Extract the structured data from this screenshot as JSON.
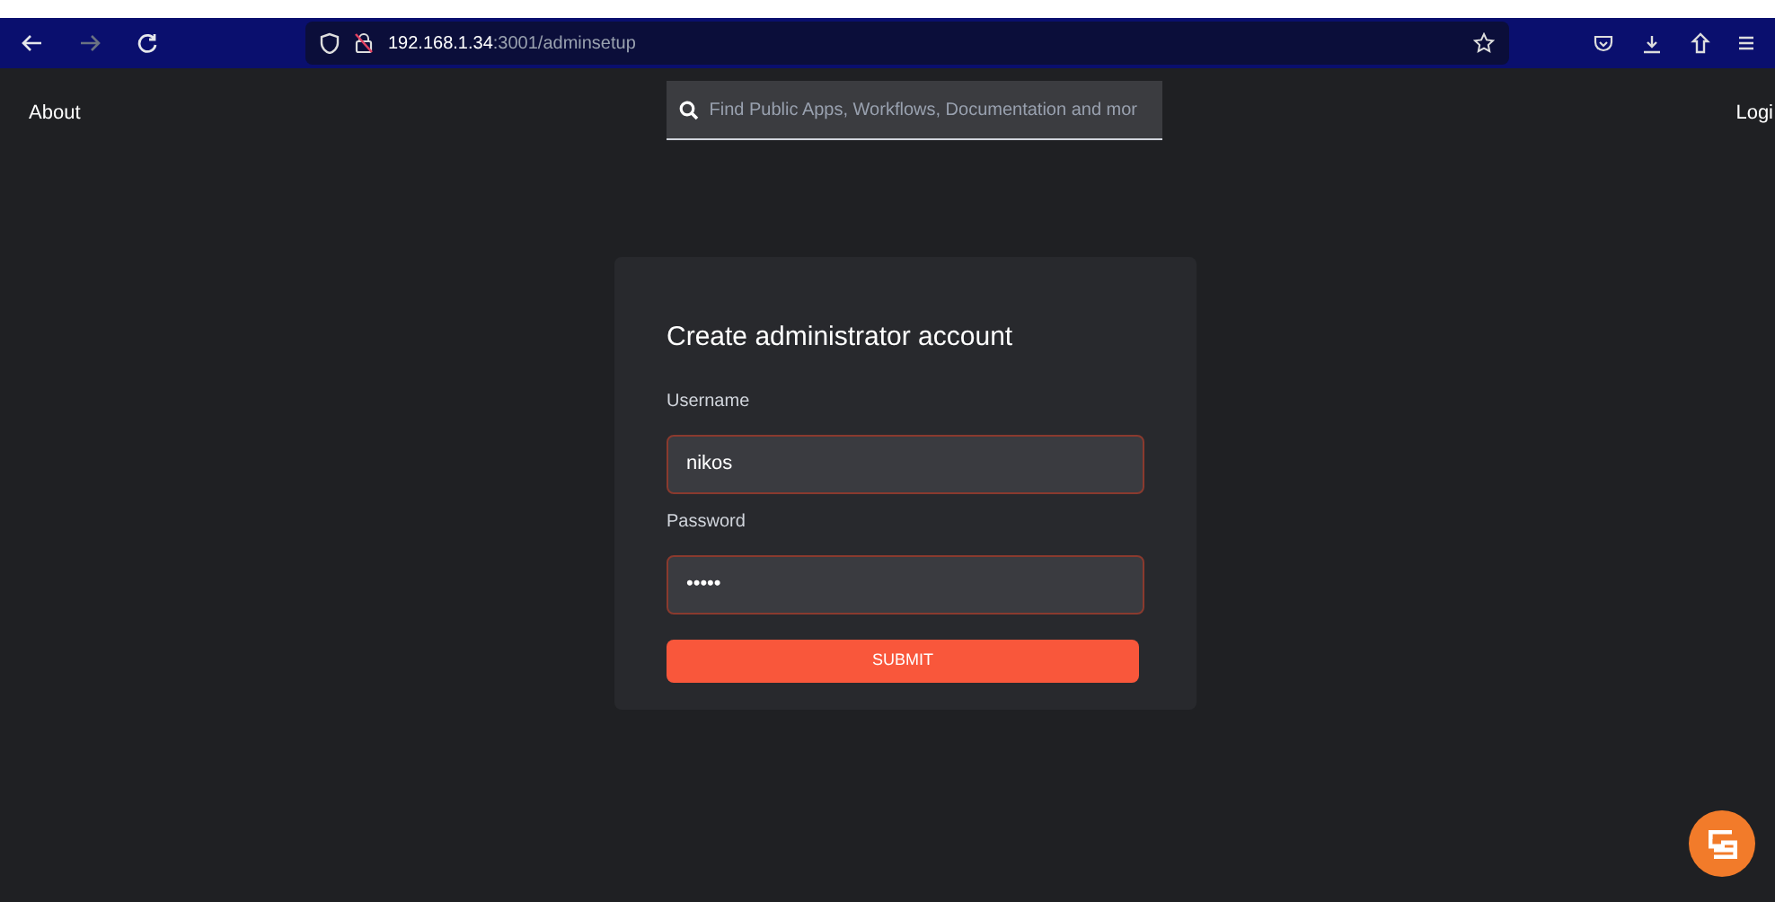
{
  "browser": {
    "url_host": "192.168.1.34",
    "url_path": ":3001/adminsetup"
  },
  "nav": {
    "about": "About",
    "search": {
      "placeholder": "Find Public Apps, Workflows, Documentation and mor"
    },
    "login": "Logi"
  },
  "form": {
    "title": "Create administrator account",
    "fields": [
      {
        "label": "Username",
        "value": "nikos"
      },
      {
        "label": "Password",
        "value": "•••••"
      }
    ],
    "submit": "SUBMIT"
  }
}
